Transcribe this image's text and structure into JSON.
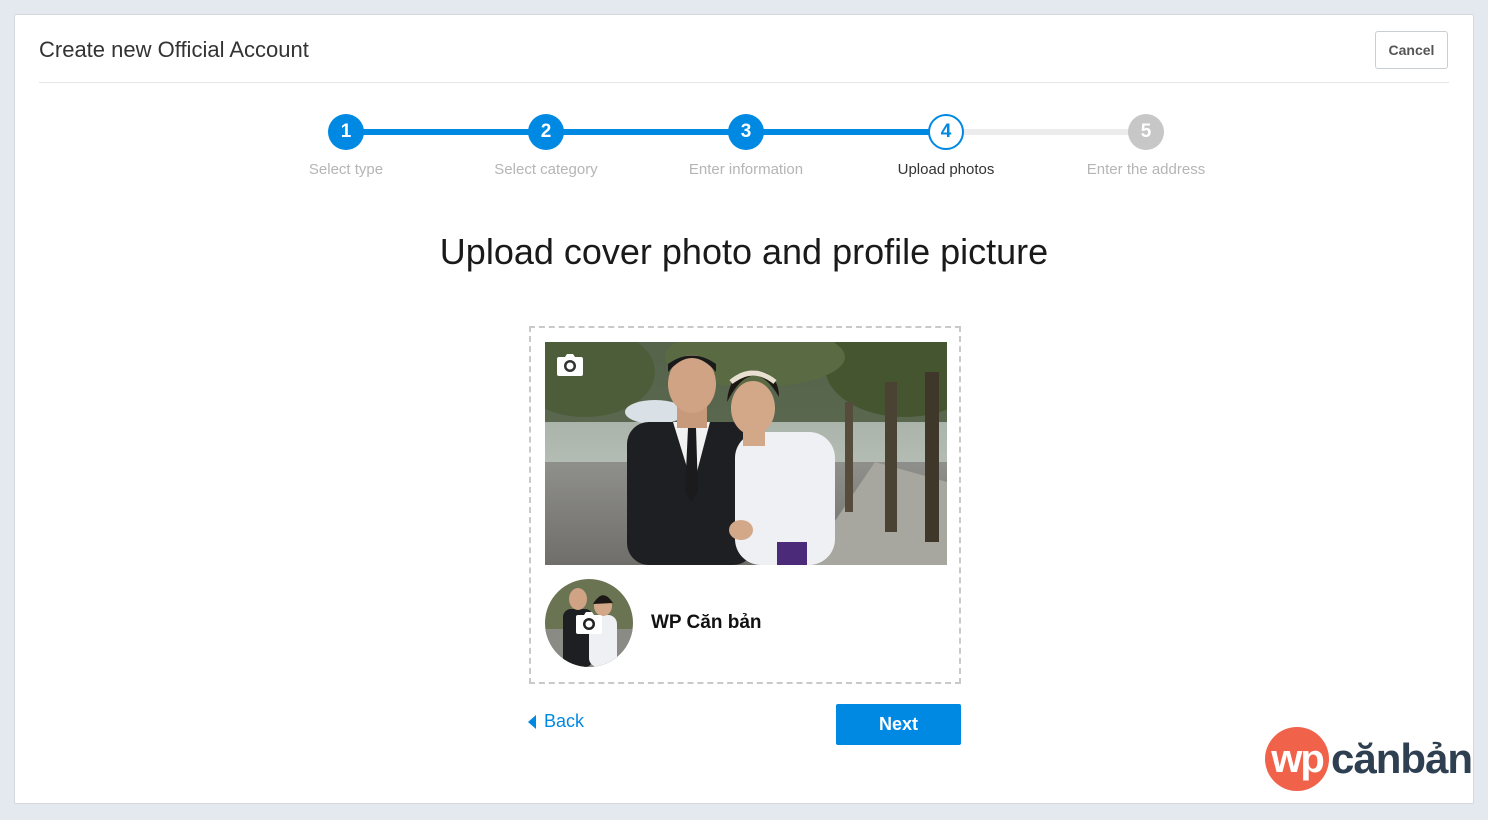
{
  "dialog": {
    "title": "Create new Official Account",
    "cancel_label": "Cancel"
  },
  "steps": [
    {
      "number": "1",
      "label": "Select type",
      "state": "done"
    },
    {
      "number": "2",
      "label": "Select category",
      "state": "done"
    },
    {
      "number": "3",
      "label": "Enter information",
      "state": "done"
    },
    {
      "number": "4",
      "label": "Upload photos",
      "state": "current"
    },
    {
      "number": "5",
      "label": "Enter the address",
      "state": "todo"
    }
  ],
  "main": {
    "heading": "Upload cover photo and profile picture",
    "page_name": "WP Căn bản"
  },
  "nav": {
    "back_label": "Back",
    "next_label": "Next"
  },
  "watermark": {
    "logo_mark": "wp",
    "logo_text": "cănbản"
  },
  "colors": {
    "accent": "#0089e3",
    "inactive_step": "#c7c7c7",
    "logo_red": "#f1624b",
    "logo_dark": "#2f3f52"
  },
  "icons": {
    "cover_camera": "camera-icon",
    "avatar_camera": "camera-icon",
    "back_arrow": "caret-left-icon"
  }
}
